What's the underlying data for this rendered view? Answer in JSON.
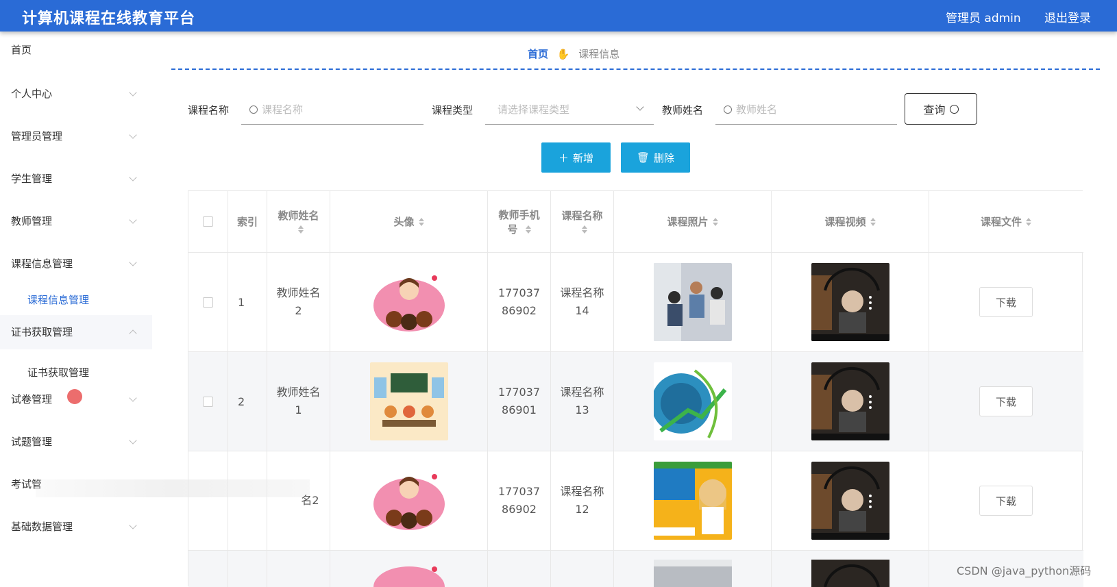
{
  "header": {
    "title": "计算机课程在线教育平台",
    "user": "管理员 admin",
    "logout": "退出登录"
  },
  "sidebar": {
    "items": [
      {
        "label": "首页"
      },
      {
        "label": "个人中心"
      },
      {
        "label": "管理员管理"
      },
      {
        "label": "学生管理"
      },
      {
        "label": "教师管理"
      },
      {
        "label": "课程信息管理"
      },
      {
        "label": "证书获取管理"
      },
      {
        "label": "试卷管理"
      },
      {
        "label": "试题管理"
      },
      {
        "label": "考试管"
      },
      {
        "label": "基础数据管理"
      }
    ],
    "sub_course": "课程信息管理",
    "sub_cert": "证书获取管理"
  },
  "breadcrumb": {
    "home": "首页",
    "current": "课程信息"
  },
  "search": {
    "course_name_label": "课程名称",
    "course_name_placeholder": "课程名称",
    "course_type_label": "课程类型",
    "course_type_placeholder": "请选择课程类型",
    "teacher_name_label": "教师姓名",
    "teacher_name_placeholder": "教师姓名",
    "query_label": "查询"
  },
  "actions": {
    "add_label": "新增",
    "delete_label": "删除"
  },
  "table": {
    "headers": {
      "index": "索引",
      "teacher_name": "教师姓名",
      "avatar": "头像",
      "phone": "教师手机号",
      "course_name": "课程名称",
      "course_photo": "课程照片",
      "course_video": "课程视频",
      "course_file": "课程文件"
    },
    "rows": [
      {
        "index": "1",
        "teacher": "教师姓名2",
        "phone": "17703786902",
        "course": "课程名称14",
        "download": "下载"
      },
      {
        "index": "2",
        "teacher": "教师姓名1",
        "phone": "17703786901",
        "course": "课程名称13",
        "download": "下载"
      },
      {
        "index": "",
        "teacher": "名2",
        "phone": "17703786902",
        "course": "课程名称12",
        "download": "下载"
      }
    ]
  },
  "watermark": "CSDN @java_python源码",
  "colors": {
    "header_bg": "#2a6bd6",
    "primary_btn": "#1aa3dc",
    "active_text": "#2a6bd6"
  }
}
